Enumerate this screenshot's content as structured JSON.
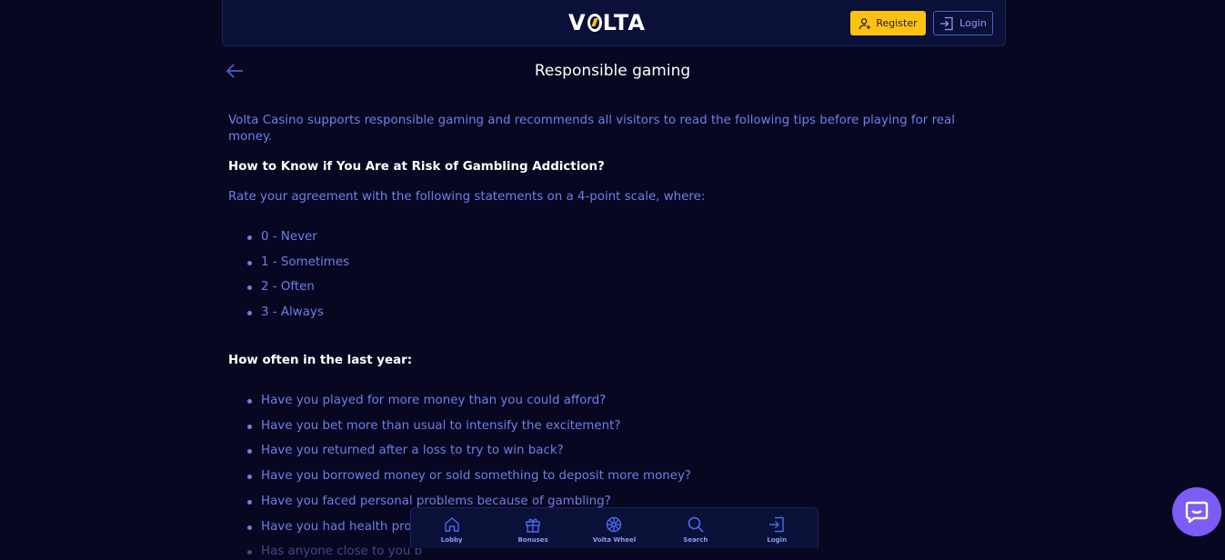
{
  "header": {
    "logo": "VOLTA",
    "register_label": "Register",
    "login_label": "Login"
  },
  "page": {
    "title": "Responsible gaming"
  },
  "content": {
    "intro": "Volta Casino supports responsible gaming and recommends all visitors to read the following tips before playing for real money.",
    "risk_heading": "How to Know if You Are at Risk of Gambling Addiction?",
    "rate_text": "Rate your agreement with the following statements on a 4-point scale, where:",
    "scale": [
      "0 - Never",
      "1 - Sometimes",
      "2 - Often",
      "3 - Always"
    ],
    "year_heading": "How often in the last year:",
    "questions": [
      "Have you played for more money than you could afford?",
      "Have you bet more than usual to intensify the excitement?",
      "Have you returned after a loss to try to win back?",
      "Have you borrowed money or sold something to deposit more money?",
      "Have you faced personal problems because of gambling?",
      "Have you had health prob",
      "Has anyone close to you b"
    ]
  },
  "bottom_nav": {
    "items": [
      {
        "label": "Lobby",
        "icon": "home-icon"
      },
      {
        "label": "Bonuses",
        "icon": "gift-icon"
      },
      {
        "label": "Volta Wheel",
        "icon": "wheel-icon"
      },
      {
        "label": "Search",
        "icon": "search-icon"
      },
      {
        "label": "Login",
        "icon": "login-icon"
      }
    ]
  },
  "colors": {
    "background": "#070721",
    "accent": "#ffc20e",
    "text": "#6f7fe8",
    "chat": "#7c5cf5"
  }
}
